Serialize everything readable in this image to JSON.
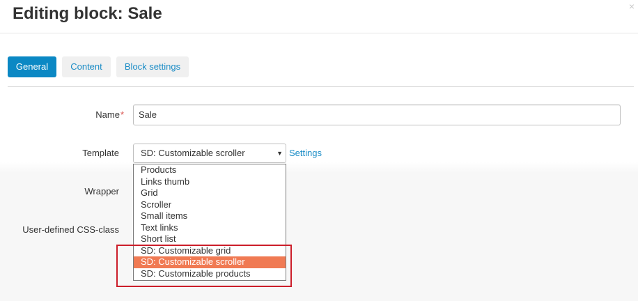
{
  "dialog": {
    "title": "Editing block: Sale",
    "close_symbol": "×"
  },
  "tabs": [
    {
      "label": "General",
      "active": true
    },
    {
      "label": "Content",
      "active": false
    },
    {
      "label": "Block settings",
      "active": false
    }
  ],
  "form": {
    "name": {
      "label": "Name",
      "required_mark": "*",
      "value": "Sale"
    },
    "template": {
      "label": "Template",
      "selected": "SD: Customizable scroller",
      "settings_link": "Settings",
      "options": [
        "Products",
        "Links thumb",
        "Grid",
        "Scroller",
        "Small items",
        "Text links",
        "Short list",
        "SD: Customizable grid",
        "SD: Customizable scroller",
        "SD: Customizable products"
      ],
      "highlighted_option": "SD: Customizable scroller"
    },
    "wrapper": {
      "label": "Wrapper"
    },
    "css_class": {
      "label": "User-defined CSS-class"
    }
  },
  "colors": {
    "accent": "#0b88c4",
    "link": "#1a8cc6",
    "option_highlight": "#f07a53",
    "annotation_box": "#cc1e2a",
    "required": "#d9534f"
  },
  "icons": {
    "close": "close-icon",
    "dropdown_arrow": "caret-down-icon"
  }
}
